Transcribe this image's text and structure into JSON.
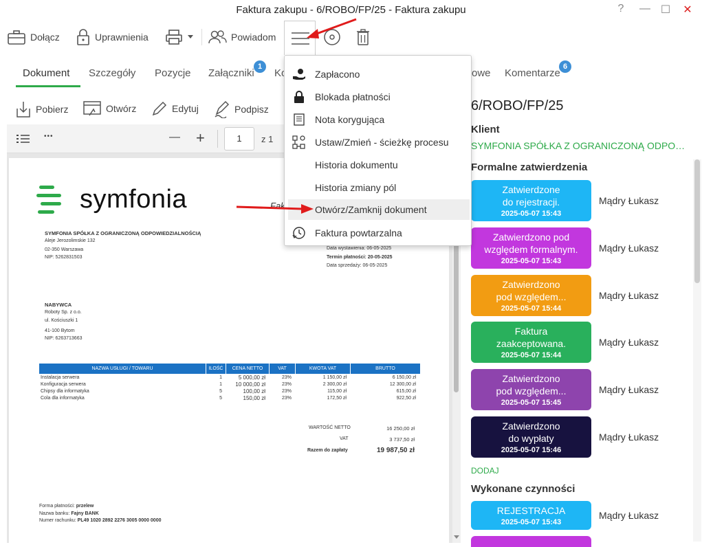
{
  "window": {
    "title": "Faktura zakupu - 6/ROBO/FP/25 - Faktura zakupu",
    "help": "?",
    "minimize": "—",
    "maximize": "☐",
    "close": "✕"
  },
  "toolbar": {
    "attach": "Dołącz",
    "permissions": "Uprawnienia",
    "notify": "Powiadom"
  },
  "tabs": [
    {
      "label": "Dokument"
    },
    {
      "label": "Szczegóły"
    },
    {
      "label": "Pozycje"
    },
    {
      "label": "Załączniki",
      "badge": "1"
    },
    {
      "label": "Ko"
    },
    {
      "label": "owe"
    },
    {
      "label": "Komentarze",
      "badge": "6"
    }
  ],
  "doc_toolbar": {
    "download": "Pobierz",
    "open": "Otwórz",
    "edit": "Edytuj",
    "sign": "Podpisz"
  },
  "viewer": {
    "page": "1",
    "of": "z 1",
    "minus": "—",
    "plus": "+",
    "more": "•••"
  },
  "menu": {
    "items": [
      {
        "label": "Zapłacono",
        "icon": "hand-coin-icon"
      },
      {
        "label": "Blokada płatności",
        "icon": "lock-icon"
      },
      {
        "label": "Nota korygująca",
        "icon": "note-icon"
      },
      {
        "label": "Ustaw/Zmień - ścieżkę procesu",
        "icon": "process-path-icon"
      },
      {
        "label": "Historia dokumentu",
        "icon": ""
      },
      {
        "label": "Historia zmiany pól",
        "icon": ""
      },
      {
        "label": "Otwórz/Zamknij dokument",
        "icon": "",
        "highlighted": true
      },
      {
        "label": "Faktura powtarzalna",
        "icon": "recurring-clock-icon"
      }
    ]
  },
  "right_panel": {
    "doc_number": "6/ROBO/FP/25",
    "client_heading": "Klient",
    "client_name": "SYMFONIA SPÓŁKA Z OGRANICZONĄ ODPOWIEDZIALNOŚCIĄ",
    "approvals_heading": "Formalne zatwierdzenia",
    "approvals": [
      {
        "status_line1": "Zatwierdzone",
        "status_line2": "do rejestracji.",
        "date": "2025-05-07 15:43",
        "user": "Mądry Łukasz",
        "color": "#1eb6f5"
      },
      {
        "status_line1": "Zatwierdzono pod",
        "status_line2": "względem formalnym.",
        "date": "2025-05-07 15:43",
        "user": "Mądry Łukasz",
        "color": "#c237de"
      },
      {
        "status_line1": "Zatwierdzono",
        "status_line2": "pod względem...",
        "date": "2025-05-07 15:44",
        "user": "Mądry Łukasz",
        "color": "#f29c12"
      },
      {
        "status_line1": "Faktura",
        "status_line2": "zaakceptowana.",
        "date": "2025-05-07 15:44",
        "user": "Mądry Łukasz",
        "color": "#29b05c"
      },
      {
        "status_line1": "Zatwierdzono",
        "status_line2": "pod względem...",
        "date": "2025-05-07 15:45",
        "user": "Mądry Łukasz",
        "color": "#8e44ad"
      },
      {
        "status_line1": "Zatwierdzono",
        "status_line2": "do wypłaty",
        "date": "2025-05-07 15:46",
        "user": "Mądry Łukasz",
        "color": "#17123f"
      }
    ],
    "add_label": "DODAJ",
    "activities_heading": "Wykonane czynności",
    "activities": [
      {
        "status": "REJESTRACJA",
        "date": "2025-05-07 15:43",
        "user": "Mądry Łukasz",
        "color": "#1eb6f5"
      }
    ]
  },
  "invoice": {
    "brand": "symfonia",
    "title_fragment": "Fakt",
    "seller_name": "SYMFONIA SPÓŁKA Z OGRANICZONĄ ODPOWIEDZIALNOŚCIĄ",
    "seller_street": "Aleje Jerozolimskie 132",
    "seller_city": "02-350 Warszawa",
    "seller_nip": "NIP: 5262831503",
    "issue_date": "Data wystawienia: 06-05-2025",
    "payment_due": "Termin płatności: 20-05-2025",
    "sale_date": "Data sprzedaży: 06-05-2025",
    "buyer_heading": "NABYWCA",
    "buyer_name": "Roboty Sp. z o.o.",
    "buyer_street": "ul. Kościuszki 1",
    "buyer_city": "41-100 Bytom",
    "buyer_nip": "NIP: 6263713663",
    "columns": [
      "NAZWA USŁUGI / TOWARU",
      "ILOŚĆ",
      "CENA NETTO",
      "VAT",
      "KWOTA VAT",
      "BRUTTO"
    ],
    "rows": [
      [
        "Instalacja serwera",
        "1",
        "5 000,00 zł",
        "23%",
        "1 150,00 zł",
        "6 150,00 zł"
      ],
      [
        "Konfiguracja serwera",
        "1",
        "10 000,00 zł",
        "23%",
        "2 300,00 zł",
        "12 300,00 zł"
      ],
      [
        "Chipsy dla informatyka",
        "5",
        "100,00 zł",
        "23%",
        "115,00 zł",
        "615,00 zł"
      ],
      [
        "Cola dla informatyka",
        "5",
        "150,00 zł",
        "23%",
        "172,50 zł",
        "922,50 zł"
      ]
    ],
    "net_label": "WARTOŚĆ NETTO",
    "net_value": "16 250,00 zł",
    "vat_label": "VAT",
    "vat_value": "3 737,50 zł",
    "total_label": "Razem do zapłaty",
    "total_value": "19 987,50 zł",
    "payment_form_label": "Forma płatności:",
    "payment_form": "przelew",
    "bank_label": "Nazwa banku:",
    "bank": "Fajny BANK",
    "account_label": "Numer rachunku:",
    "account": "PL49 1020 2892 2276 3005 0000 0000"
  }
}
